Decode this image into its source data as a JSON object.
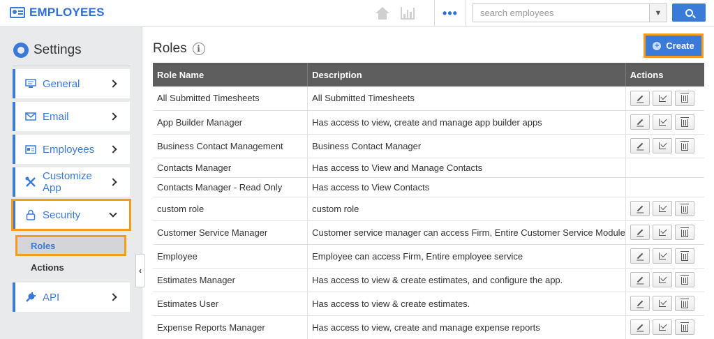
{
  "app": {
    "title": "EMPLOYEES"
  },
  "search": {
    "placeholder": "search employees"
  },
  "topbar": {
    "more_label": "•••"
  },
  "sidebar": {
    "title": "Settings",
    "items": [
      {
        "label": "General",
        "icon": "monitor-icon"
      },
      {
        "label": "Email",
        "icon": "envelope-icon"
      },
      {
        "label": "Employees",
        "icon": "id-card-icon"
      },
      {
        "label": "Customize App",
        "icon": "tools-icon"
      },
      {
        "label": "Security",
        "icon": "lock-icon",
        "expanded": true
      },
      {
        "label": "API",
        "icon": "plug-icon"
      }
    ],
    "security_sub": [
      {
        "label": "Roles",
        "selected": true
      },
      {
        "label": "Actions",
        "selected": false
      }
    ],
    "collapse_glyph": "‹"
  },
  "main": {
    "title": "Roles",
    "info_glyph": "i",
    "create_label": "Create",
    "table": {
      "headers": [
        "Role Name",
        "Description",
        "Actions"
      ],
      "rows": [
        {
          "name": "All Submitted Timesheets",
          "desc": "All Submitted Timesheets",
          "actions": true
        },
        {
          "name": "App Builder Manager",
          "desc": "Has access to view, create and manage app builder apps",
          "actions": true
        },
        {
          "name": "Business Contact Management",
          "desc": "Business Contact Manager",
          "actions": true
        },
        {
          "name": "Contacts Manager",
          "desc": "Has access to View and Manage Contacts",
          "actions": false
        },
        {
          "name": "Contacts Manager - Read Only",
          "desc": "Has access to View Contacts",
          "actions": false
        },
        {
          "name": "custom role",
          "desc": "custom role",
          "actions": true
        },
        {
          "name": "Customer Service Manager",
          "desc": "Customer service manager can access Firm, Entire Customer Service Module",
          "actions": true
        },
        {
          "name": "Employee",
          "desc": "Employee can access Firm, Entire employee service",
          "actions": true
        },
        {
          "name": "Estimates Manager",
          "desc": "Has access to view & create estimates, and configure the app.",
          "actions": true
        },
        {
          "name": "Estimates User",
          "desc": "Has access to view & create estimates.",
          "actions": true
        },
        {
          "name": "Expense Reports Manager",
          "desc": "Has access to view, create and manage expense reports",
          "actions": true
        }
      ]
    }
  },
  "colors": {
    "accent": "#3a7ad8",
    "highlight": "#f39c1d",
    "header_bg": "#5e5e5e",
    "sidebar_bg": "#e9eaec"
  }
}
